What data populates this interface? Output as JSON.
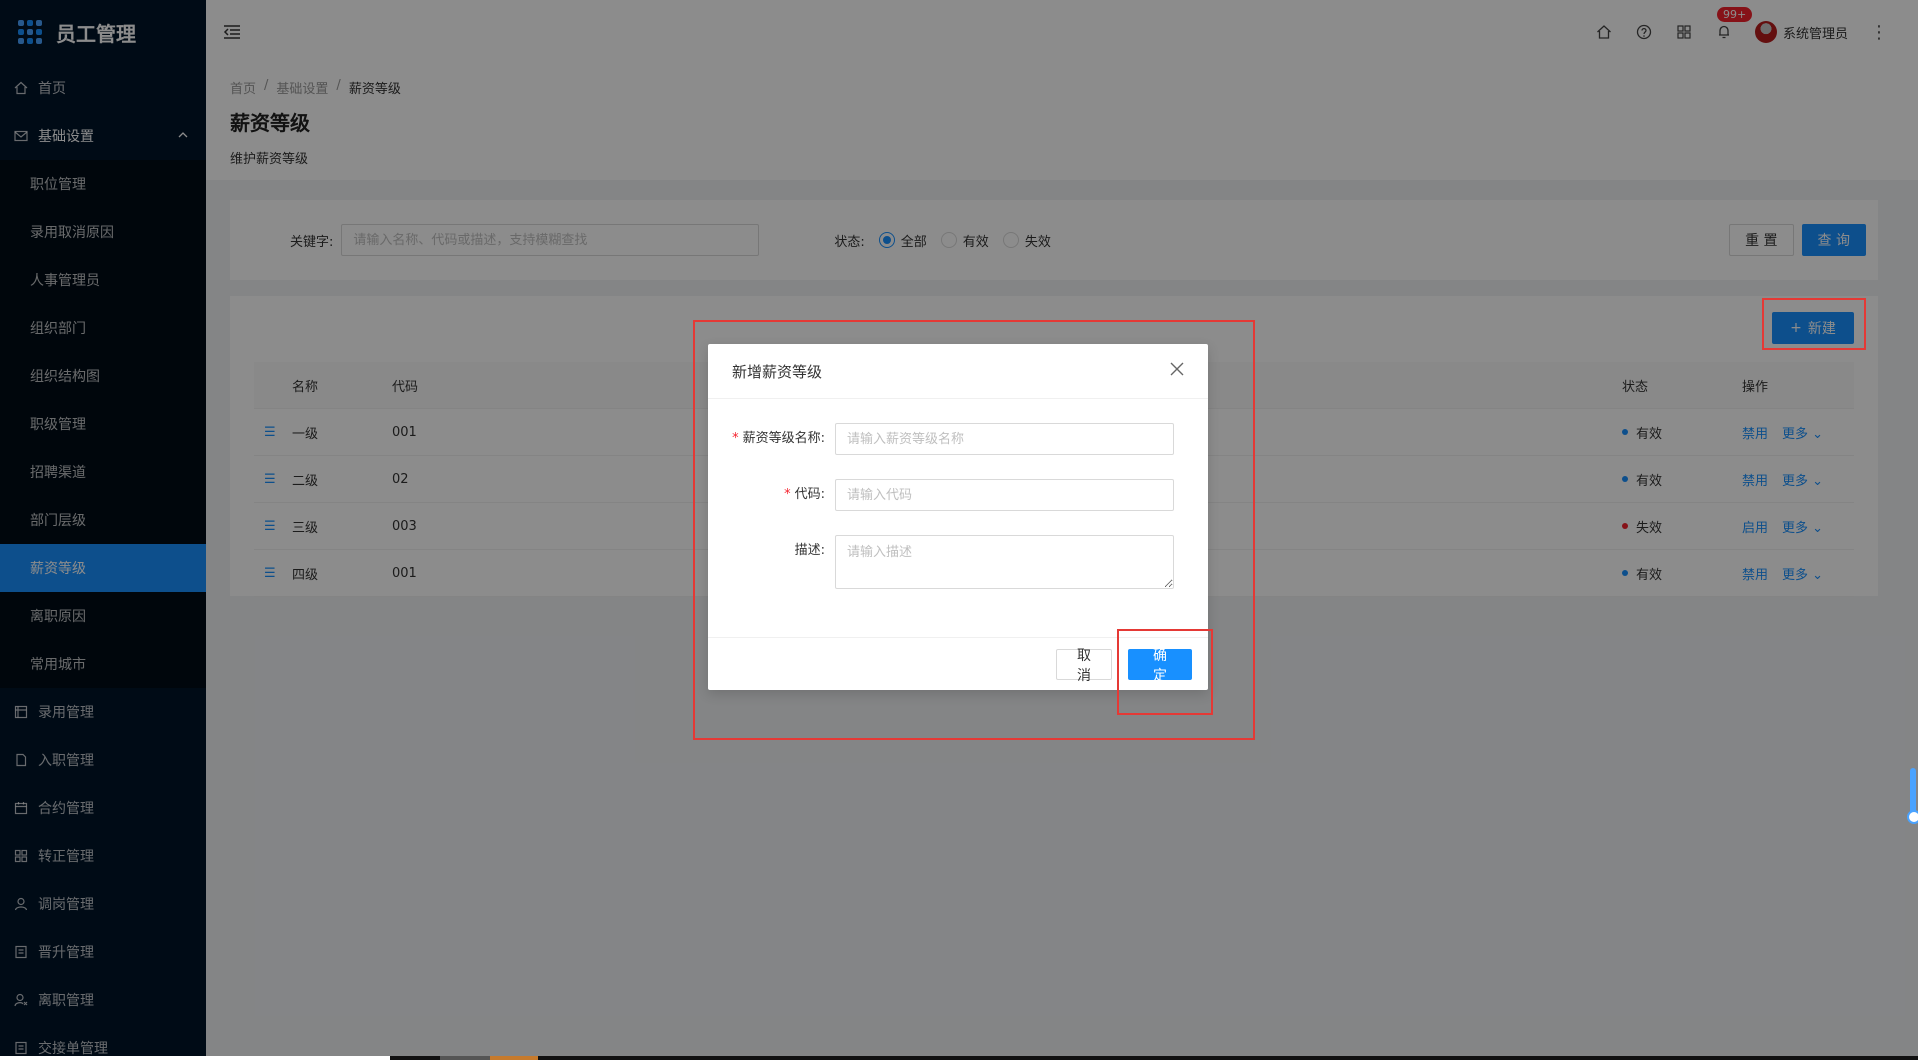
{
  "app": {
    "title": "员工管理"
  },
  "sidebar": {
    "items": [
      {
        "label": "首页",
        "icon": "home-icon"
      },
      {
        "label": "基础设置",
        "icon": "mail-icon",
        "open": true,
        "arrow": "⌃"
      },
      {
        "label": "录用管理",
        "icon": "calendar-icon"
      },
      {
        "label": "入职管理",
        "icon": "file-icon"
      },
      {
        "label": "合约管理",
        "icon": "calendar-icon"
      },
      {
        "label": "转正管理",
        "icon": "cluster-icon"
      },
      {
        "label": "调岗管理",
        "icon": "user-icon"
      },
      {
        "label": "晋升管理",
        "icon": "file-icon"
      },
      {
        "label": "离职管理",
        "icon": "user-leave-icon"
      },
      {
        "label": "交接单管理",
        "icon": "file-icon"
      }
    ],
    "submenu": [
      "职位管理",
      "录用取消原因",
      "人事管理员",
      "组织部门",
      "组织结构图",
      "职级管理",
      "招聘渠道",
      "部门层级",
      "薪资等级",
      "离职原因",
      "常用城市"
    ],
    "active_submenu": "薪资等级"
  },
  "header": {
    "badge": "99+",
    "user_name": "系统管理员"
  },
  "page": {
    "breadcrumb": [
      "首页",
      "基础设置",
      "薪资等级"
    ],
    "title": "薪资等级",
    "description": "维护薪资等级"
  },
  "search": {
    "keyword_label": "关键字:",
    "keyword_placeholder": "请输入名称、代码或描述，支持模糊查找",
    "status_label": "状态:",
    "status_options": [
      "全部",
      "有效",
      "失效"
    ],
    "status_selected": "全部",
    "reset_label": "重 置",
    "query_label": "查 询"
  },
  "table": {
    "new_label": "新建",
    "columns": {
      "name": "名称",
      "code": "代码",
      "status": "状态",
      "ops": "操作"
    },
    "rows": [
      {
        "name": "一级",
        "code": "001",
        "status": "有效",
        "active": true,
        "action": "禁用",
        "more": "更多"
      },
      {
        "name": "二级",
        "code": "02",
        "status": "有效",
        "active": true,
        "action": "禁用",
        "more": "更多"
      },
      {
        "name": "三级",
        "code": "003",
        "status": "失效",
        "active": false,
        "action": "启用",
        "more": "更多"
      },
      {
        "name": "四级",
        "code": "001",
        "status": "有效",
        "active": true,
        "action": "禁用",
        "more": "更多"
      }
    ]
  },
  "modal": {
    "title": "新增薪资等级",
    "fields": {
      "name": {
        "label": "薪资等级名称:",
        "placeholder": "请输入薪资等级名称",
        "value": ""
      },
      "code": {
        "label": "代码:",
        "placeholder": "请输入代码",
        "value": ""
      },
      "desc": {
        "label": "描述:",
        "placeholder": "请输入描述",
        "value": ""
      }
    },
    "cancel_label": "取 消",
    "ok_label": "确 定"
  },
  "colors": {
    "sidebar_bg": "#001529",
    "primary": "#1890ff",
    "danger": "#f5222d",
    "annotation": "#e53935"
  }
}
